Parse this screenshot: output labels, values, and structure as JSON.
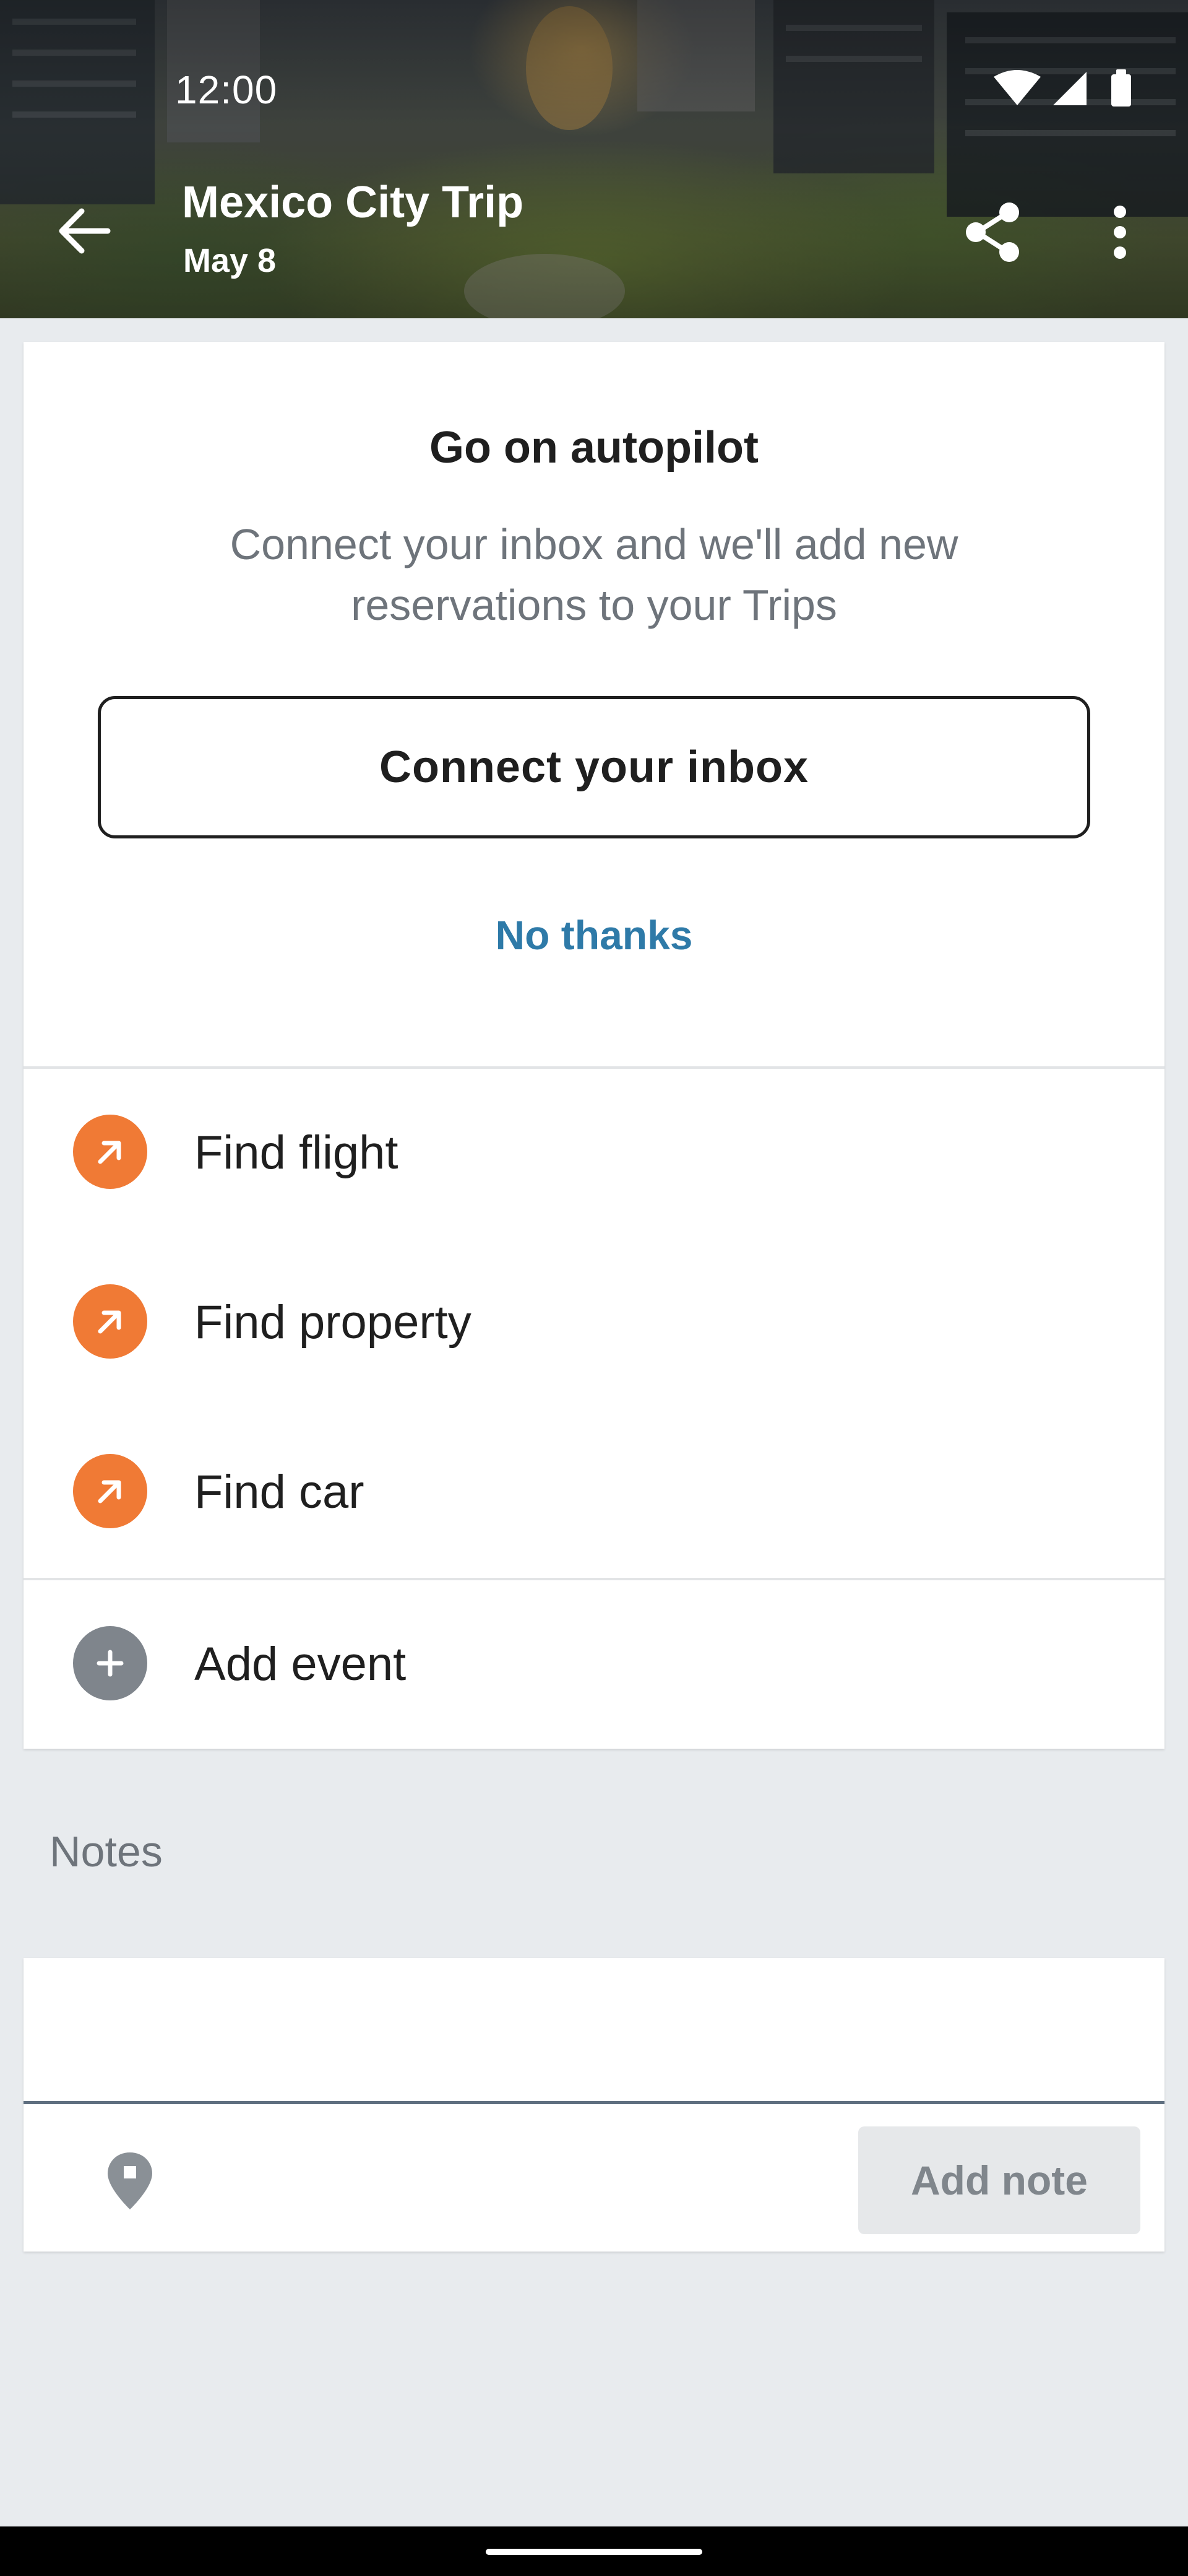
{
  "status_bar": {
    "time": "12:00"
  },
  "header": {
    "title": "Mexico City Trip",
    "date": "May 8",
    "icons": {
      "back": "arrow-back-icon",
      "share": "share-icon",
      "more": "more-vert-icon"
    }
  },
  "autopilot": {
    "title": "Go on autopilot",
    "description": "Connect your inbox and we'll add new reservations to your Trips",
    "connect_label": "Connect your inbox",
    "dismiss_label": "No thanks"
  },
  "actions": [
    {
      "label": "Find flight",
      "icon": "arrow-up-right-icon",
      "color": "#f07a35"
    },
    {
      "label": "Find property",
      "icon": "arrow-up-right-icon",
      "color": "#f07a35"
    },
    {
      "label": "Find car",
      "icon": "arrow-up-right-icon",
      "color": "#f07a35"
    },
    {
      "label": "Add event",
      "icon": "plus-icon",
      "color": "#7f858c"
    }
  ],
  "notes": {
    "heading": "Notes",
    "input_value": "",
    "add_label": "Add note",
    "pin_icon": "location-pin-icon"
  },
  "colors": {
    "accent_orange": "#f07a35",
    "link_blue": "#2e7aa8",
    "background": "#e8ebee"
  }
}
